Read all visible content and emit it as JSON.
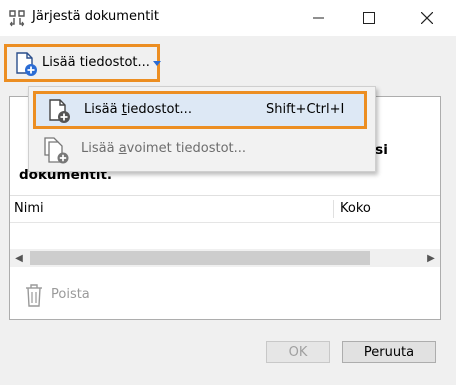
{
  "window": {
    "title": "Järjestä dokumentit",
    "controls": [
      "minimize",
      "maximize",
      "close"
    ]
  },
  "toolbar": {
    "add_files_label": "Lisää tiedostot...",
    "icon": "add-document-icon"
  },
  "menu": {
    "items": [
      {
        "label": "Lisää tiedostot...",
        "shortcut": "Shift+Ctrl+I",
        "icon": "add-document-icon"
      },
      {
        "label": "Lisää avoimet tiedostot...",
        "shortcut": "",
        "icon": "add-open-documents-icon"
      }
    ]
  },
  "panel": {
    "hint_end": "masi",
    "hint_line2": "dokumentit.",
    "columns": [
      "Nimi",
      "Koko"
    ]
  },
  "remove": {
    "label": "Poista"
  },
  "buttons": {
    "ok": "OK",
    "cancel": "Peruuta"
  },
  "colors": {
    "highlight_border": "#ec8e22",
    "accent_blue": "#2b6cd4"
  }
}
